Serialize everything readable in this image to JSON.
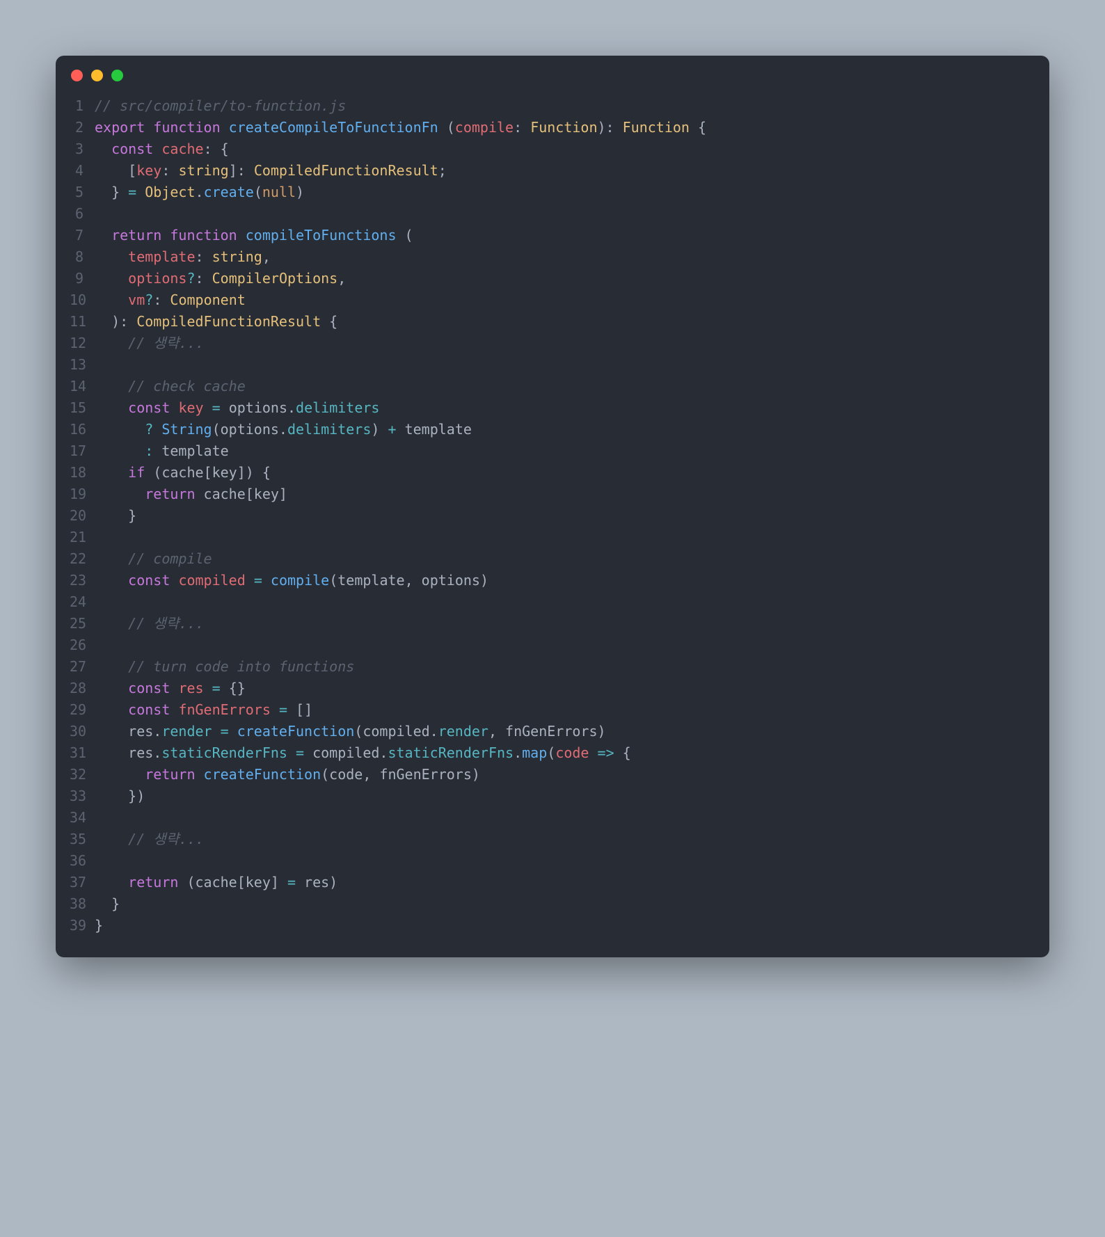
{
  "window": {
    "traffic_lights": [
      "red",
      "yellow",
      "green"
    ]
  },
  "code": {
    "language": "typescript",
    "lines": [
      {
        "n": 1,
        "tokens": [
          [
            "c",
            "// src/compiler/to-function.js"
          ]
        ]
      },
      {
        "n": 2,
        "tokens": [
          [
            "k",
            "export"
          ],
          [
            "d",
            " "
          ],
          [
            "k",
            "function"
          ],
          [
            "d",
            " "
          ],
          [
            "fn",
            "createCompileToFunctionFn"
          ],
          [
            "d",
            " ("
          ],
          [
            "v",
            "compile"
          ],
          [
            "d",
            ": "
          ],
          [
            "t",
            "Function"
          ],
          [
            "d",
            "): "
          ],
          [
            "t",
            "Function"
          ],
          [
            "d",
            " {"
          ]
        ]
      },
      {
        "n": 3,
        "tokens": [
          [
            "d",
            "  "
          ],
          [
            "k",
            "const"
          ],
          [
            "d",
            " "
          ],
          [
            "v",
            "cache"
          ],
          [
            "d",
            ": {"
          ]
        ]
      },
      {
        "n": 4,
        "tokens": [
          [
            "d",
            "    ["
          ],
          [
            "v",
            "key"
          ],
          [
            "d",
            ": "
          ],
          [
            "t",
            "string"
          ],
          [
            "d",
            "]: "
          ],
          [
            "t",
            "CompiledFunctionResult"
          ],
          [
            "d",
            ";"
          ]
        ]
      },
      {
        "n": 5,
        "tokens": [
          [
            "d",
            "  } "
          ],
          [
            "op",
            "="
          ],
          [
            "d",
            " "
          ],
          [
            "t",
            "Object"
          ],
          [
            "d",
            "."
          ],
          [
            "fn",
            "create"
          ],
          [
            "d",
            "("
          ],
          [
            "nl",
            "null"
          ],
          [
            "d",
            ")"
          ]
        ]
      },
      {
        "n": 6,
        "tokens": [
          [
            "d",
            ""
          ]
        ]
      },
      {
        "n": 7,
        "tokens": [
          [
            "d",
            "  "
          ],
          [
            "k",
            "return"
          ],
          [
            "d",
            " "
          ],
          [
            "k",
            "function"
          ],
          [
            "d",
            " "
          ],
          [
            "fn",
            "compileToFunctions"
          ],
          [
            "d",
            " ("
          ]
        ]
      },
      {
        "n": 8,
        "tokens": [
          [
            "d",
            "    "
          ],
          [
            "v",
            "template"
          ],
          [
            "d",
            ": "
          ],
          [
            "t",
            "string"
          ],
          [
            "d",
            ","
          ]
        ]
      },
      {
        "n": 9,
        "tokens": [
          [
            "d",
            "    "
          ],
          [
            "v",
            "options"
          ],
          [
            "op",
            "?"
          ],
          [
            "d",
            ": "
          ],
          [
            "t",
            "CompilerOptions"
          ],
          [
            "d",
            ","
          ]
        ]
      },
      {
        "n": 10,
        "tokens": [
          [
            "d",
            "    "
          ],
          [
            "v",
            "vm"
          ],
          [
            "op",
            "?"
          ],
          [
            "d",
            ": "
          ],
          [
            "t",
            "Component"
          ]
        ]
      },
      {
        "n": 11,
        "tokens": [
          [
            "d",
            "  ): "
          ],
          [
            "t",
            "CompiledFunctionResult"
          ],
          [
            "d",
            " {"
          ]
        ]
      },
      {
        "n": 12,
        "tokens": [
          [
            "d",
            "    "
          ],
          [
            "c",
            "// 생략..."
          ]
        ]
      },
      {
        "n": 13,
        "tokens": [
          [
            "d",
            ""
          ]
        ]
      },
      {
        "n": 14,
        "tokens": [
          [
            "d",
            "    "
          ],
          [
            "c",
            "// check cache"
          ]
        ]
      },
      {
        "n": 15,
        "tokens": [
          [
            "d",
            "    "
          ],
          [
            "k",
            "const"
          ],
          [
            "d",
            " "
          ],
          [
            "v",
            "key"
          ],
          [
            "d",
            " "
          ],
          [
            "op",
            "="
          ],
          [
            "d",
            " options."
          ],
          [
            "p",
            "delimiters"
          ]
        ]
      },
      {
        "n": 16,
        "tokens": [
          [
            "d",
            "      "
          ],
          [
            "op",
            "?"
          ],
          [
            "d",
            " "
          ],
          [
            "fn",
            "String"
          ],
          [
            "d",
            "(options."
          ],
          [
            "p",
            "delimiters"
          ],
          [
            "d",
            ") "
          ],
          [
            "op",
            "+"
          ],
          [
            "d",
            " template"
          ]
        ]
      },
      {
        "n": 17,
        "tokens": [
          [
            "d",
            "      "
          ],
          [
            "op",
            ":"
          ],
          [
            "d",
            " template"
          ]
        ]
      },
      {
        "n": 18,
        "tokens": [
          [
            "d",
            "    "
          ],
          [
            "k",
            "if"
          ],
          [
            "d",
            " (cache[key]) {"
          ]
        ]
      },
      {
        "n": 19,
        "tokens": [
          [
            "d",
            "      "
          ],
          [
            "k",
            "return"
          ],
          [
            "d",
            " cache[key]"
          ]
        ]
      },
      {
        "n": 20,
        "tokens": [
          [
            "d",
            "    }"
          ]
        ]
      },
      {
        "n": 21,
        "tokens": [
          [
            "d",
            ""
          ]
        ]
      },
      {
        "n": 22,
        "tokens": [
          [
            "d",
            "    "
          ],
          [
            "c",
            "// compile"
          ]
        ]
      },
      {
        "n": 23,
        "tokens": [
          [
            "d",
            "    "
          ],
          [
            "k",
            "const"
          ],
          [
            "d",
            " "
          ],
          [
            "v",
            "compiled"
          ],
          [
            "d",
            " "
          ],
          [
            "op",
            "="
          ],
          [
            "d",
            " "
          ],
          [
            "fn",
            "compile"
          ],
          [
            "d",
            "(template, options)"
          ]
        ]
      },
      {
        "n": 24,
        "tokens": [
          [
            "d",
            ""
          ]
        ]
      },
      {
        "n": 25,
        "tokens": [
          [
            "d",
            "    "
          ],
          [
            "c",
            "// 생략..."
          ]
        ]
      },
      {
        "n": 26,
        "tokens": [
          [
            "d",
            ""
          ]
        ]
      },
      {
        "n": 27,
        "tokens": [
          [
            "d",
            "    "
          ],
          [
            "c",
            "// turn code into functions"
          ]
        ]
      },
      {
        "n": 28,
        "tokens": [
          [
            "d",
            "    "
          ],
          [
            "k",
            "const"
          ],
          [
            "d",
            " "
          ],
          [
            "v",
            "res"
          ],
          [
            "d",
            " "
          ],
          [
            "op",
            "="
          ],
          [
            "d",
            " {}"
          ]
        ]
      },
      {
        "n": 29,
        "tokens": [
          [
            "d",
            "    "
          ],
          [
            "k",
            "const"
          ],
          [
            "d",
            " "
          ],
          [
            "v",
            "fnGenErrors"
          ],
          [
            "d",
            " "
          ],
          [
            "op",
            "="
          ],
          [
            "d",
            " []"
          ]
        ]
      },
      {
        "n": 30,
        "tokens": [
          [
            "d",
            "    res."
          ],
          [
            "p",
            "render"
          ],
          [
            "d",
            " "
          ],
          [
            "op",
            "="
          ],
          [
            "d",
            " "
          ],
          [
            "fn",
            "createFunction"
          ],
          [
            "d",
            "(compiled."
          ],
          [
            "p",
            "render"
          ],
          [
            "d",
            ", fnGenErrors)"
          ]
        ]
      },
      {
        "n": 31,
        "tokens": [
          [
            "d",
            "    res."
          ],
          [
            "p",
            "staticRenderFns"
          ],
          [
            "d",
            " "
          ],
          [
            "op",
            "="
          ],
          [
            "d",
            " compiled."
          ],
          [
            "p",
            "staticRenderFns"
          ],
          [
            "d",
            "."
          ],
          [
            "fn",
            "map"
          ],
          [
            "d",
            "("
          ],
          [
            "v",
            "code"
          ],
          [
            "d",
            " "
          ],
          [
            "op",
            "=>"
          ],
          [
            "d",
            " {"
          ]
        ]
      },
      {
        "n": 32,
        "tokens": [
          [
            "d",
            "      "
          ],
          [
            "k",
            "return"
          ],
          [
            "d",
            " "
          ],
          [
            "fn",
            "createFunction"
          ],
          [
            "d",
            "(code, fnGenErrors)"
          ]
        ]
      },
      {
        "n": 33,
        "tokens": [
          [
            "d",
            "    })"
          ]
        ]
      },
      {
        "n": 34,
        "tokens": [
          [
            "d",
            ""
          ]
        ]
      },
      {
        "n": 35,
        "tokens": [
          [
            "d",
            "    "
          ],
          [
            "c",
            "// 생략..."
          ]
        ]
      },
      {
        "n": 36,
        "tokens": [
          [
            "d",
            ""
          ]
        ]
      },
      {
        "n": 37,
        "tokens": [
          [
            "d",
            "    "
          ],
          [
            "k",
            "return"
          ],
          [
            "d",
            " (cache[key] "
          ],
          [
            "op",
            "="
          ],
          [
            "d",
            " res)"
          ]
        ]
      },
      {
        "n": 38,
        "tokens": [
          [
            "d",
            "  }"
          ]
        ]
      },
      {
        "n": 39,
        "tokens": [
          [
            "d",
            "}"
          ]
        ]
      }
    ]
  }
}
